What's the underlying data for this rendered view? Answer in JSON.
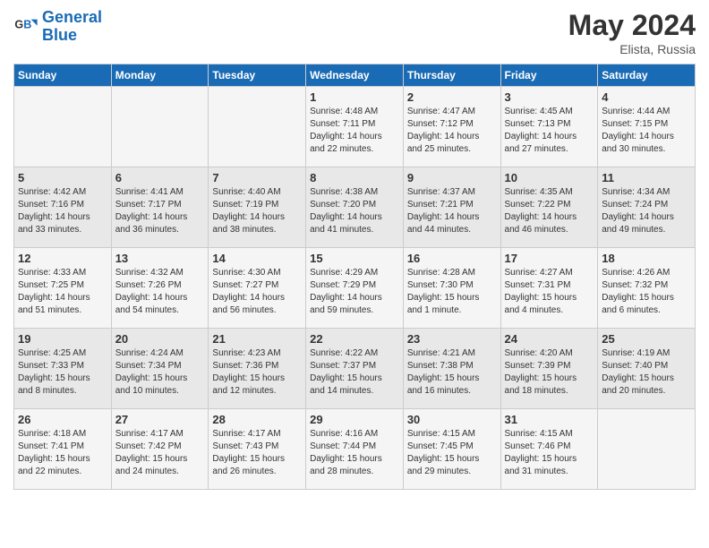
{
  "header": {
    "logo_text_general": "General",
    "logo_text_blue": "Blue",
    "month_title": "May 2024",
    "location": "Elista, Russia"
  },
  "weekdays": [
    "Sunday",
    "Monday",
    "Tuesday",
    "Wednesday",
    "Thursday",
    "Friday",
    "Saturday"
  ],
  "weeks": [
    [
      {
        "day": "",
        "info": ""
      },
      {
        "day": "",
        "info": ""
      },
      {
        "day": "",
        "info": ""
      },
      {
        "day": "1",
        "info": "Sunrise: 4:48 AM\nSunset: 7:11 PM\nDaylight: 14 hours\nand 22 minutes."
      },
      {
        "day": "2",
        "info": "Sunrise: 4:47 AM\nSunset: 7:12 PM\nDaylight: 14 hours\nand 25 minutes."
      },
      {
        "day": "3",
        "info": "Sunrise: 4:45 AM\nSunset: 7:13 PM\nDaylight: 14 hours\nand 27 minutes."
      },
      {
        "day": "4",
        "info": "Sunrise: 4:44 AM\nSunset: 7:15 PM\nDaylight: 14 hours\nand 30 minutes."
      }
    ],
    [
      {
        "day": "5",
        "info": "Sunrise: 4:42 AM\nSunset: 7:16 PM\nDaylight: 14 hours\nand 33 minutes."
      },
      {
        "day": "6",
        "info": "Sunrise: 4:41 AM\nSunset: 7:17 PM\nDaylight: 14 hours\nand 36 minutes."
      },
      {
        "day": "7",
        "info": "Sunrise: 4:40 AM\nSunset: 7:19 PM\nDaylight: 14 hours\nand 38 minutes."
      },
      {
        "day": "8",
        "info": "Sunrise: 4:38 AM\nSunset: 7:20 PM\nDaylight: 14 hours\nand 41 minutes."
      },
      {
        "day": "9",
        "info": "Sunrise: 4:37 AM\nSunset: 7:21 PM\nDaylight: 14 hours\nand 44 minutes."
      },
      {
        "day": "10",
        "info": "Sunrise: 4:35 AM\nSunset: 7:22 PM\nDaylight: 14 hours\nand 46 minutes."
      },
      {
        "day": "11",
        "info": "Sunrise: 4:34 AM\nSunset: 7:24 PM\nDaylight: 14 hours\nand 49 minutes."
      }
    ],
    [
      {
        "day": "12",
        "info": "Sunrise: 4:33 AM\nSunset: 7:25 PM\nDaylight: 14 hours\nand 51 minutes."
      },
      {
        "day": "13",
        "info": "Sunrise: 4:32 AM\nSunset: 7:26 PM\nDaylight: 14 hours\nand 54 minutes."
      },
      {
        "day": "14",
        "info": "Sunrise: 4:30 AM\nSunset: 7:27 PM\nDaylight: 14 hours\nand 56 minutes."
      },
      {
        "day": "15",
        "info": "Sunrise: 4:29 AM\nSunset: 7:29 PM\nDaylight: 14 hours\nand 59 minutes."
      },
      {
        "day": "16",
        "info": "Sunrise: 4:28 AM\nSunset: 7:30 PM\nDaylight: 15 hours\nand 1 minute."
      },
      {
        "day": "17",
        "info": "Sunrise: 4:27 AM\nSunset: 7:31 PM\nDaylight: 15 hours\nand 4 minutes."
      },
      {
        "day": "18",
        "info": "Sunrise: 4:26 AM\nSunset: 7:32 PM\nDaylight: 15 hours\nand 6 minutes."
      }
    ],
    [
      {
        "day": "19",
        "info": "Sunrise: 4:25 AM\nSunset: 7:33 PM\nDaylight: 15 hours\nand 8 minutes."
      },
      {
        "day": "20",
        "info": "Sunrise: 4:24 AM\nSunset: 7:34 PM\nDaylight: 15 hours\nand 10 minutes."
      },
      {
        "day": "21",
        "info": "Sunrise: 4:23 AM\nSunset: 7:36 PM\nDaylight: 15 hours\nand 12 minutes."
      },
      {
        "day": "22",
        "info": "Sunrise: 4:22 AM\nSunset: 7:37 PM\nDaylight: 15 hours\nand 14 minutes."
      },
      {
        "day": "23",
        "info": "Sunrise: 4:21 AM\nSunset: 7:38 PM\nDaylight: 15 hours\nand 16 minutes."
      },
      {
        "day": "24",
        "info": "Sunrise: 4:20 AM\nSunset: 7:39 PM\nDaylight: 15 hours\nand 18 minutes."
      },
      {
        "day": "25",
        "info": "Sunrise: 4:19 AM\nSunset: 7:40 PM\nDaylight: 15 hours\nand 20 minutes."
      }
    ],
    [
      {
        "day": "26",
        "info": "Sunrise: 4:18 AM\nSunset: 7:41 PM\nDaylight: 15 hours\nand 22 minutes."
      },
      {
        "day": "27",
        "info": "Sunrise: 4:17 AM\nSunset: 7:42 PM\nDaylight: 15 hours\nand 24 minutes."
      },
      {
        "day": "28",
        "info": "Sunrise: 4:17 AM\nSunset: 7:43 PM\nDaylight: 15 hours\nand 26 minutes."
      },
      {
        "day": "29",
        "info": "Sunrise: 4:16 AM\nSunset: 7:44 PM\nDaylight: 15 hours\nand 28 minutes."
      },
      {
        "day": "30",
        "info": "Sunrise: 4:15 AM\nSunset: 7:45 PM\nDaylight: 15 hours\nand 29 minutes."
      },
      {
        "day": "31",
        "info": "Sunrise: 4:15 AM\nSunset: 7:46 PM\nDaylight: 15 hours\nand 31 minutes."
      },
      {
        "day": "",
        "info": ""
      }
    ]
  ]
}
